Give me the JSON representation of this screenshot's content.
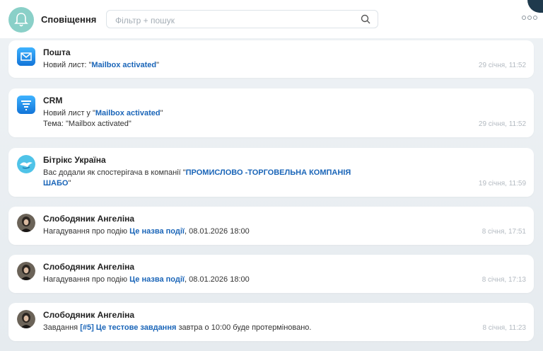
{
  "header": {
    "title": "Сповіщення",
    "search_placeholder": "Фільтр + пошук",
    "icons": {
      "bell": "bell-icon",
      "search": "search-icon",
      "more": "more-icon"
    },
    "accent_color": "#8ad0c8"
  },
  "notifications": [
    {
      "icon": "mail-icon",
      "title": "Пошта",
      "line1_prefix": "Новий лист: \"",
      "line1_link": "Mailbox activated",
      "line1_suffix": "\"",
      "time": "29 січня, 11:52"
    },
    {
      "icon": "crm-icon",
      "title": "CRM",
      "line1_prefix": "Новий лист у \"",
      "line1_link": "Mailbox activated",
      "line1_suffix": "\"",
      "line2": "Тема: \"Mailbox activated\"",
      "time": "29 січня, 11:52"
    },
    {
      "icon": "bitrix-logo-icon",
      "title": "Бітрікс Україна",
      "line1_prefix": "Вас додали як спостерігача в компанії \"",
      "line1_link": "ПРОМИСЛОВО -ТОРГОВЕЛЬНА КОМПАНІЯ",
      "line2_link": "ШАБО",
      "line2_suffix": "\"",
      "time": "19 січня, 11:59"
    },
    {
      "icon": "user-avatar",
      "title": "Слободяник Ангеліна",
      "line1_prefix": "Нагадування про подію ",
      "line1_link": "Це назва події",
      "line1_suffix": ", 08.01.2026 18:00",
      "time": "8 січня, 17:51"
    },
    {
      "icon": "user-avatar",
      "title": "Слободяник Ангеліна",
      "line1_prefix": "Нагадування про подію ",
      "line1_link": "Це назва події",
      "line1_suffix": ", 08.01.2026 18:00",
      "time": "8 січня, 17:13"
    },
    {
      "icon": "user-avatar",
      "title": "Слободяник Ангеліна",
      "line1_prefix": "Завдання ",
      "line1_link": "[#5] Це тестове завдання",
      "line1_suffix": " завтра о 10:00 буде протерміновано.",
      "time": "8 січня, 11:23"
    }
  ]
}
